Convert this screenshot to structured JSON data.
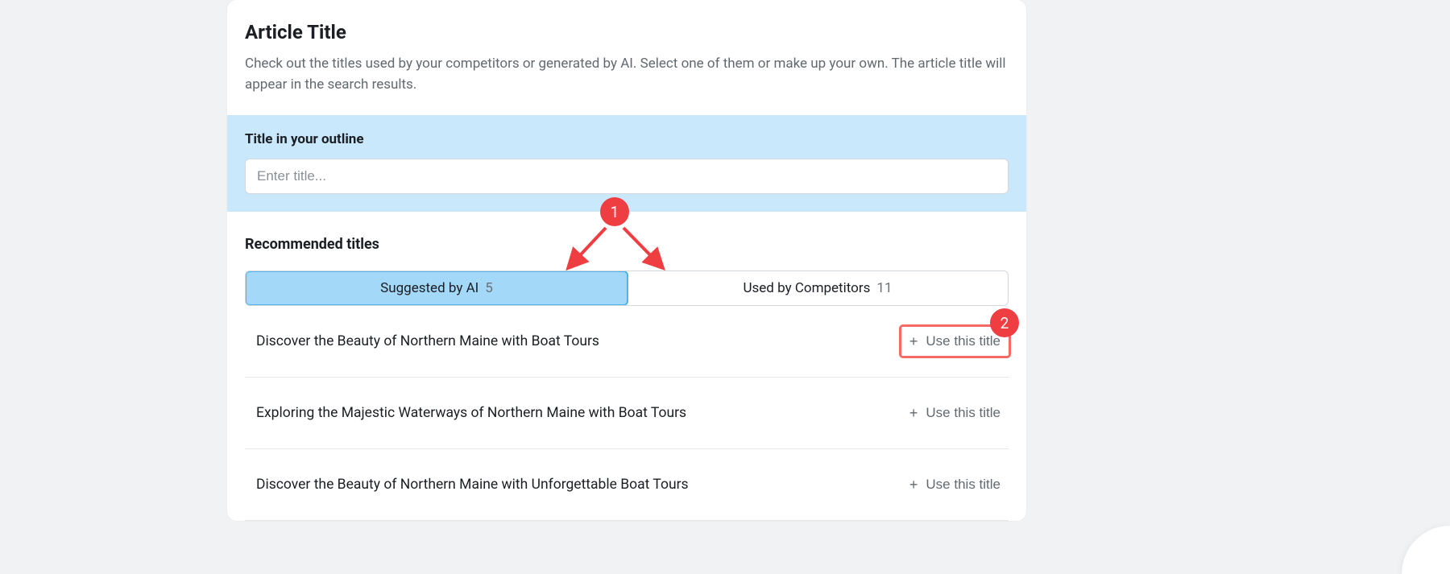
{
  "header": {
    "title": "Article Title",
    "description": "Check out the titles used by your competitors or generated by AI. Select one of them or make up your own. The article title will appear in the search results."
  },
  "outline": {
    "label": "Title in your outline",
    "placeholder": "Enter title..."
  },
  "recommended": {
    "heading": "Recommended titles",
    "tabs": {
      "ai": {
        "label": "Suggested by AI",
        "count": "5"
      },
      "competitors": {
        "label": "Used by Competitors",
        "count": "11"
      }
    },
    "use_label": "Use this title",
    "titles": [
      "Discover the Beauty of Northern Maine with Boat Tours",
      "Exploring the Majestic Waterways of Northern Maine with Boat Tours",
      "Discover the Beauty of Northern Maine with Unforgettable Boat Tours"
    ]
  },
  "annotations": {
    "marker1": "1",
    "marker2": "2"
  }
}
